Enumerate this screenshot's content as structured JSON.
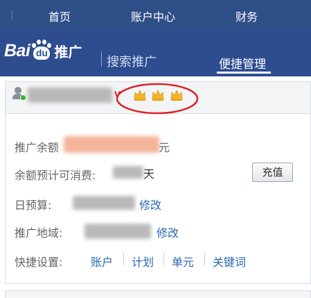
{
  "topnav": {
    "items": [
      "首页",
      "账户中心",
      "财务"
    ]
  },
  "brand": {
    "logo_bai": "Bai",
    "logo_du": "du",
    "logo_tuiguang": "推广",
    "subtitle": "搜索推广",
    "active_tab": "便捷管理"
  },
  "account": {
    "level_mark": "v",
    "crown_count": 3,
    "crown_color": "#f5b52a",
    "highlight_color": "#d9262c",
    "online_status_color": "#2fb42f"
  },
  "info": {
    "balance_label": "推广余额",
    "balance_suffix": "元",
    "spend_label": "余额预计可消费:",
    "spend_suffix": "天",
    "recharge_button": "充值",
    "budget_label": "日预算:",
    "budget_edit": "修改",
    "region_label": "推广地域:",
    "region_edit": "修改"
  },
  "quick": {
    "label": "快捷设置:",
    "links": [
      "账户",
      "计划",
      "单元",
      "关键词"
    ]
  },
  "colors": {
    "nav_bg": "#2f4f88",
    "brand_bg": "#2d4d8f",
    "link": "#2a67b3"
  }
}
